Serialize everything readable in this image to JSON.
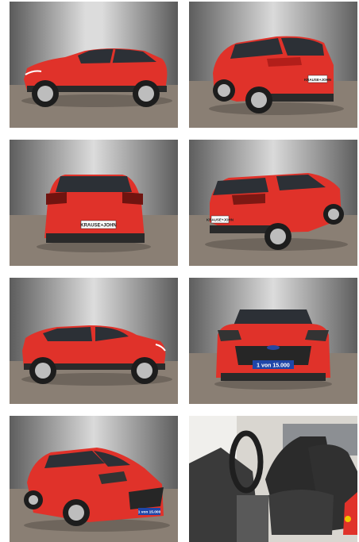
{
  "gallery": {
    "photos": [
      {
        "view": "side-left",
        "plate": ""
      },
      {
        "view": "rear-three-quarter-left",
        "plate": "KRAUSE+JOHN"
      },
      {
        "view": "rear",
        "plate": "KRAUSE+JOHN"
      },
      {
        "view": "rear-three-quarter-right",
        "plate": "KRAUSE+JOHN"
      },
      {
        "view": "side-right",
        "plate": ""
      },
      {
        "view": "front",
        "plate": "1 von 15.000"
      },
      {
        "view": "front-three-quarter",
        "plate": "1 von 15.000"
      },
      {
        "view": "interior-driver-seat",
        "plate": ""
      }
    ]
  },
  "colors": {
    "car_body": "#e0322a",
    "car_dark": "#a91d18",
    "backdrop_top": "#5d5d5d",
    "backdrop_mid": "#d9d9d9",
    "floor": "#8a7f74",
    "plate_blue": "#1f46a8"
  }
}
